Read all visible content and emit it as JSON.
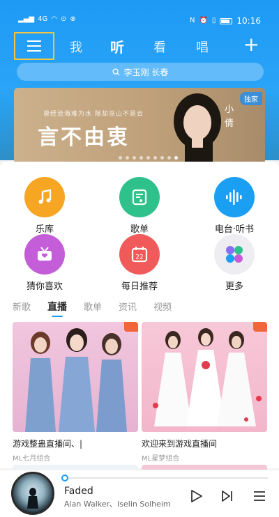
{
  "status": {
    "left_text": "4G",
    "time": "10:16"
  },
  "nav": {
    "tabs": [
      "我",
      "听",
      "看",
      "唱"
    ],
    "active_tab": "听"
  },
  "search": {
    "placeholder": "李玉刚 长春"
  },
  "banner": {
    "small_text": "曾经沧海难为水  除却巫山不是云",
    "title": "言不由衷",
    "artist": "小倩",
    "badge": "独家",
    "slide_count": 9,
    "active_slide": 8
  },
  "grid": [
    {
      "label": "乐库",
      "icon": "music-note-icon",
      "color": "#f6a623"
    },
    {
      "label": "歌单",
      "icon": "playlist-icon",
      "color": "#2fc18c"
    },
    {
      "label": "电台·听书",
      "icon": "sound-wave-icon",
      "color": "#1a9ff2"
    },
    {
      "label": "猜你喜欢",
      "icon": "radio-icon",
      "color": "#c45ed8"
    },
    {
      "label": "每日推荐",
      "icon": "calendar-icon",
      "color": "#f05a5a",
      "calendar_day": "22"
    },
    {
      "label": "更多",
      "icon": "more-apps-icon",
      "color": "#eeeef2"
    }
  ],
  "subtabs": [
    "新歌",
    "直播",
    "歌单",
    "资讯",
    "视频"
  ],
  "active_subtab": "直播",
  "cards": [
    {
      "title": "游戏整蛊直播间、|",
      "subtitle": "ML七月组合"
    },
    {
      "title": "欢迎来到游戏直播间",
      "subtitle": "ML星梦组合"
    }
  ],
  "player": {
    "song": "Faded",
    "artist": "Alan Walker、Iselin Solheim",
    "progress": 0.0
  }
}
